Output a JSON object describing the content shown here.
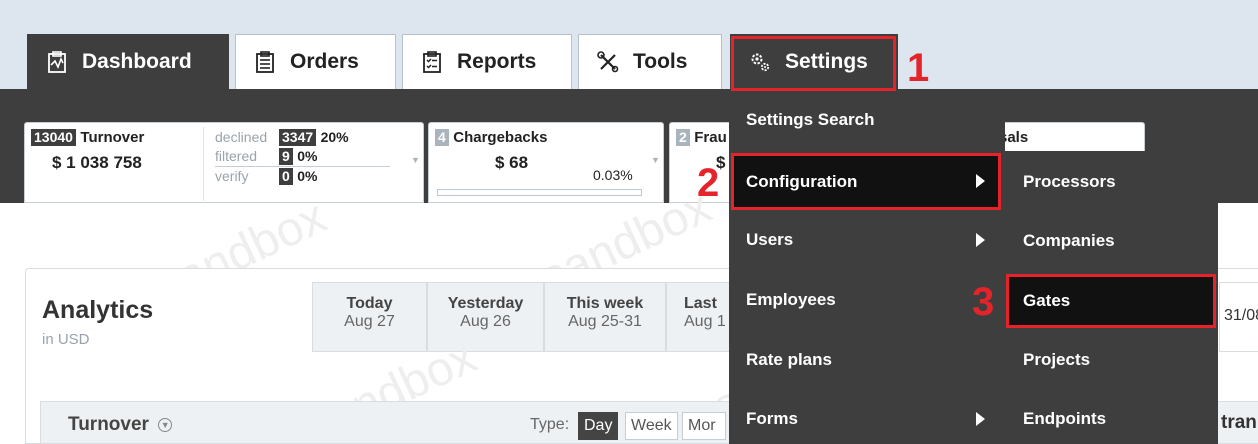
{
  "tabs": [
    {
      "label": "Dashboard",
      "icon": "clipboard-chart-icon"
    },
    {
      "label": "Orders",
      "icon": "clipboard-list-icon"
    },
    {
      "label": "Reports",
      "icon": "clipboard-checklist-icon"
    },
    {
      "label": "Tools",
      "icon": "wrench-screwdriver-icon"
    },
    {
      "label": "Settings",
      "icon": "gears-icon"
    }
  ],
  "cards": {
    "turnover": {
      "count": "13040",
      "label": "Turnover",
      "amount": "$ 1 038 758",
      "rows": [
        {
          "label": "declined",
          "count": "3347",
          "pct": "20%"
        },
        {
          "label": "filtered",
          "count": "9",
          "pct": "0%"
        },
        {
          "label": "verify",
          "count": "0",
          "pct": "0%"
        }
      ]
    },
    "chargebacks": {
      "count": "4",
      "label": "Chargebacks",
      "amount": "$ 68",
      "pct": "0.03%"
    },
    "fraud": {
      "count": "2",
      "label": "Frau",
      "amount": "$"
    },
    "refusals": {
      "label": "sals"
    }
  },
  "watermark": "sandbox",
  "analytics": {
    "title": "Analytics",
    "subtitle": "in USD",
    "periods": [
      {
        "label": "Today",
        "date": "Aug 27"
      },
      {
        "label": "Yesterday",
        "date": "Aug 26"
      },
      {
        "label": "This week",
        "date": "Aug 25-31"
      },
      {
        "label": "Last",
        "date": "Aug 1"
      }
    ],
    "date_fragment": "31/08",
    "right_fragment": "tran"
  },
  "turnover_panel": {
    "title": "Turnover",
    "type_label": "Type:",
    "types": [
      "Day",
      "Week",
      "Mor"
    ],
    "active_type": "Day"
  },
  "settings_menu": {
    "items": [
      {
        "label": "Settings Search",
        "has_submenu": false
      },
      {
        "label": "Configuration",
        "has_submenu": true
      },
      {
        "label": "Users",
        "has_submenu": true
      },
      {
        "label": "Employees",
        "has_submenu": false
      },
      {
        "label": "Rate plans",
        "has_submenu": false
      },
      {
        "label": "Forms",
        "has_submenu": true
      }
    ]
  },
  "configuration_submenu": {
    "items": [
      "Processors",
      "Companies",
      "Gates",
      "Projects",
      "Endpoints"
    ]
  },
  "annotations": {
    "step1": "1",
    "step2": "2",
    "step3": "3"
  },
  "colors": {
    "dark": "#3e3e3e",
    "highlight_red": "#e5232b",
    "topbar": "#dde6ee"
  }
}
